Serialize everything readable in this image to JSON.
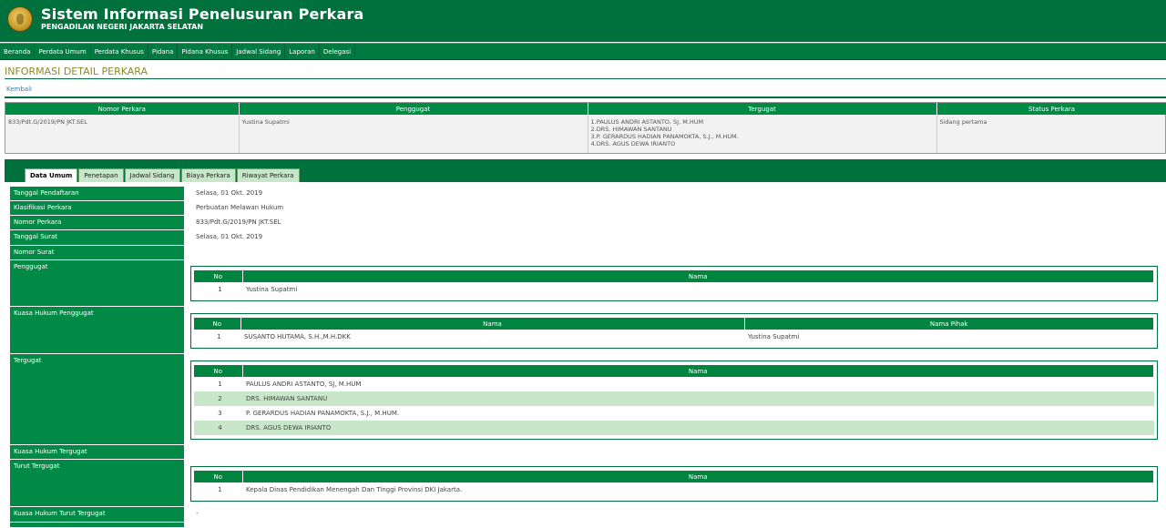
{
  "header": {
    "title": "Sistem Informasi Penelusuran Perkara",
    "subtitle": "PENGADILAN NEGERI JAKARTA SELATAN",
    "logo_icon": "court-emblem-icon"
  },
  "nav": [
    "Beranda",
    "Perdata Umum",
    "Perdata Khusus",
    "Pidana",
    "Pidana Khusus",
    "Jadwal Sidang",
    "Laporan",
    "Delegasi"
  ],
  "page": {
    "title": "INFORMASI DETAIL PERKARA",
    "back_label": "Kembali"
  },
  "summary": {
    "headers": [
      "Nomor Perkara",
      "Penggugat",
      "Tergugat",
      "Status Perkara"
    ],
    "nomor": "833/Pdt.G/2019/PN JKT.SEL",
    "penggugat": "Yustina Supatmi",
    "tergugat": [
      "1.PAULUS ANDRI ASTANTO, SJ, M.HUM",
      "2.DRS. HIMAWAN SANTANU",
      "3.P. GERARDUS HADIAN PANAMOKTA, S.J., M.HUM.",
      "4.DRS. AGUS DEWA IRIANTO"
    ],
    "status": "Sidang pertama"
  },
  "tabs": [
    "Data Umum",
    "Penetapan",
    "Jadwal Sidang",
    "Biaya Perkara",
    "Riwayat Perkara"
  ],
  "detail": {
    "tanggal_pendaftaran": {
      "label": "Tanggal Pendaftaran",
      "value": "Selasa, 01 Okt. 2019"
    },
    "klasifikasi": {
      "label": "Klasifikasi Perkara",
      "value": "Perbuatan Melawan Hukum"
    },
    "nomor": {
      "label": "Nomor Perkara",
      "value": "833/Pdt.G/2019/PN JKT.SEL"
    },
    "tanggal_surat": {
      "label": "Tanggal Surat",
      "value": "Selasa, 01 Okt. 2019"
    },
    "nomor_surat": {
      "label": "Nomor Surat",
      "value": ""
    },
    "penggugat": {
      "label": "Penggugat",
      "col_no": "No",
      "col_nama": "Nama",
      "rows": [
        {
          "no": "1",
          "nama": "Yustina Supatmi"
        }
      ]
    },
    "kuasa_penggugat": {
      "label": "Kuasa Hukum Penggugat",
      "col_no": "No",
      "col_nama": "Nama",
      "col_pihak": "Nama Pihak",
      "rows": [
        {
          "no": "1",
          "nama": "SUSANTO HUTAMA, S.H.,M.H.DKK",
          "pihak": "Yustina Supatmi"
        }
      ]
    },
    "tergugat": {
      "label": "Tergugat",
      "col_no": "No",
      "col_nama": "Nama",
      "rows": [
        {
          "no": "1",
          "nama": "PAULUS ANDRI ASTANTO, SJ, M.HUM"
        },
        {
          "no": "2",
          "nama": "DRS. HIMAWAN SANTANU"
        },
        {
          "no": "3",
          "nama": "P. GERARDUS HADIAN PANAMOKTA, S.J., M.HUM."
        },
        {
          "no": "4",
          "nama": "DRS. AGUS DEWA IRIANTO"
        }
      ]
    },
    "kuasa_tergugat": {
      "label": "Kuasa Hukum Tergugat",
      "value": ""
    },
    "turut_tergugat": {
      "label": "Turut Tergugat",
      "col_no": "No",
      "col_nama": "Nama",
      "rows": [
        {
          "no": "1",
          "nama": "Kepala Dinas Pendidikan Menengah Dan Tinggi Provinsi DKI Jakarta."
        }
      ]
    },
    "kuasa_turut_tergugat": {
      "label": "Kuasa Hukum Turut Tergugat",
      "value": "-"
    }
  },
  "colors": {
    "primary": "#00703c",
    "accent": "#008a45",
    "zebra": "#c8e6c9"
  }
}
